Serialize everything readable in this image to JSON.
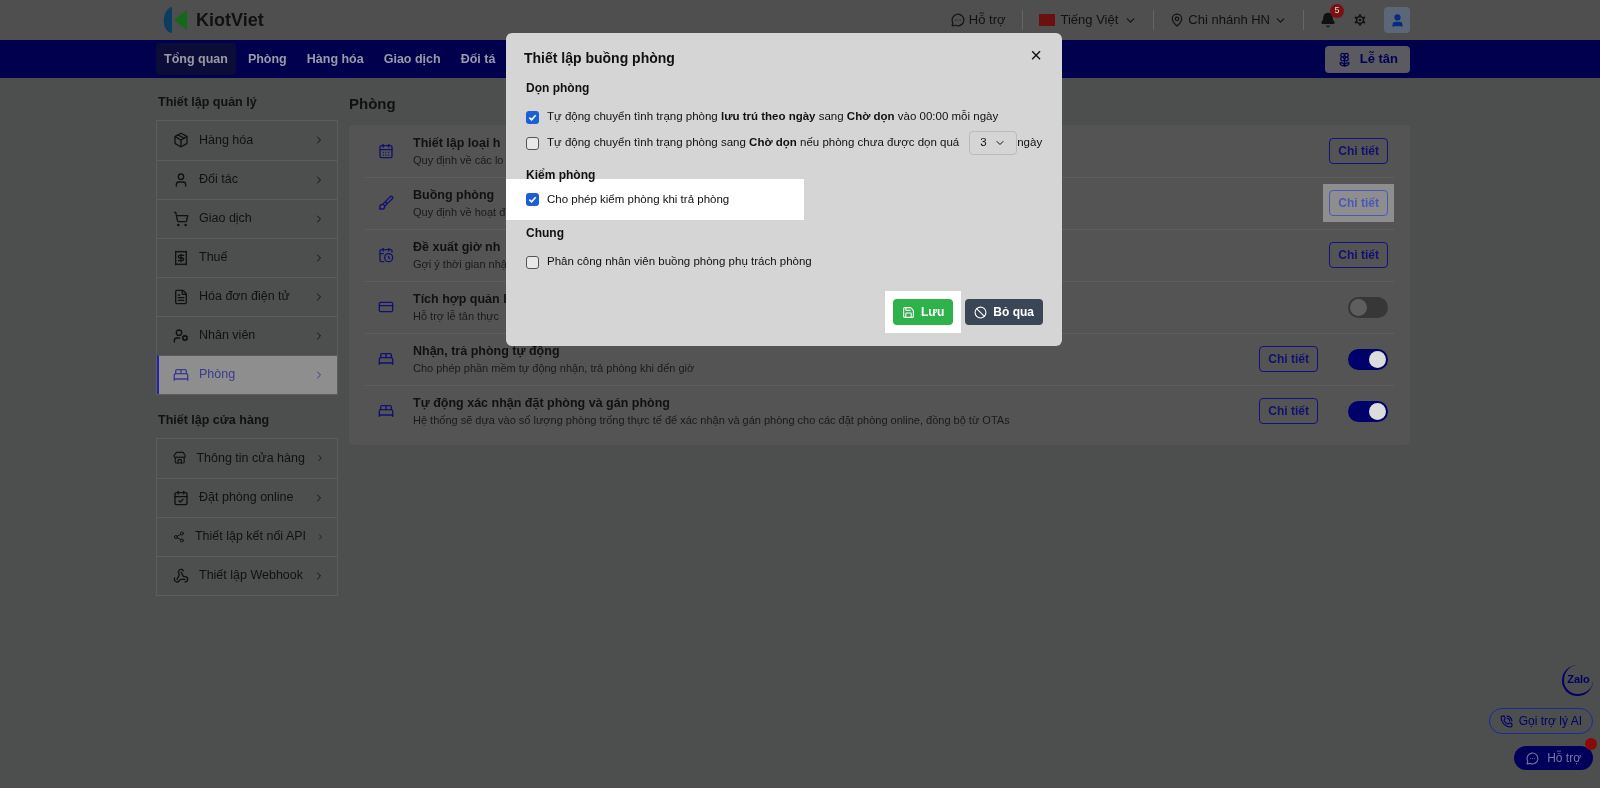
{
  "header": {
    "logo": "KiotViet",
    "support": "Hỗ trợ",
    "language": "Tiếng Việt",
    "branch": "Chi nhánh HN",
    "notification_count": "5"
  },
  "nav": {
    "tabs": [
      {
        "label": "Tổng quan",
        "selected": true
      },
      {
        "label": "Phòng",
        "selected": false
      },
      {
        "label": "Hàng hóa",
        "selected": false
      },
      {
        "label": "Giao dịch",
        "selected": false
      },
      {
        "label": "Đối tá",
        "selected": false
      }
    ],
    "reception_button": "Lễ tân"
  },
  "sidebar": [
    {
      "title": "Thiết lập quản lý",
      "items": [
        {
          "label": "Hàng hóa",
          "selected": false
        },
        {
          "label": "Đối tác",
          "selected": false
        },
        {
          "label": "Giao dịch",
          "selected": false
        },
        {
          "label": "Thuế",
          "selected": false
        },
        {
          "label": "Hóa đơn điện tử",
          "selected": false
        },
        {
          "label": "Nhân viên",
          "selected": false
        },
        {
          "label": "Phòng",
          "selected": true
        }
      ]
    },
    {
      "title": "Thiết lập cửa hàng",
      "items": [
        {
          "label": "Thông tin cửa hàng",
          "selected": false
        },
        {
          "label": "Đặt phòng online",
          "selected": false
        },
        {
          "label": "Thiết lập kết nối API",
          "selected": false
        },
        {
          "label": "Thiết lập Webhook",
          "selected": false
        }
      ]
    }
  ],
  "content": {
    "title": "Phòng",
    "rows": [
      {
        "title": "Thiết lập loại h",
        "description": "Quy định về các lo",
        "detail_button": "Chi tiết",
        "highlighted": false
      },
      {
        "title": "Buồng phòng",
        "description": "Quy định về hoạt đ",
        "detail_button": "Chi tiết",
        "highlighted": true
      },
      {
        "title": "Đề xuất giờ nh",
        "description": "Gợi ý thời gian nhậ",
        "detail_button": "Chi tiết",
        "highlighted": false
      },
      {
        "title": "Tích hợp quản l",
        "description": "Hỗ trợ lễ tân thực",
        "on": false
      },
      {
        "title": "Nhận, trả phòng tự động",
        "description": "Cho phép phần mềm tự động nhận, trả phòng khi đến giờ",
        "detail_button": "Chi tiết",
        "highlighted": false,
        "on": true
      },
      {
        "title": "Tự động xác nhận đặt phòng và gán phòng",
        "description": "Hệ thống sẽ dựa vào số lượng phòng trống thực tế để xác nhận và gán phòng cho các đặt phòng online, đồng bộ từ OTAs",
        "detail_button": "Chi tiết",
        "highlighted": false,
        "on": true
      }
    ]
  },
  "dialog": {
    "title": "Thiết lập buồng phòng",
    "close": "×",
    "sections": [
      {
        "title": "Dọn phòng",
        "options": [
          {
            "text": "Tự động chuyển tình trạng phòng **lưu trú theo ngày** sang **Chờ dọn** vào 00:00 mỗi ngày",
            "checked": true,
            "highlighted": false
          },
          {
            "text": "Tự động chuyển tình trạng phòng sang **Chờ dọn** nếu phòng chưa được dọn quá",
            "checked": false,
            "highlighted": false,
            "select_value": "3",
            "suffix": "ngày"
          }
        ]
      },
      {
        "title": "Kiểm phòng",
        "options": [
          {
            "text": "Cho phép kiểm phòng khi trả phòng",
            "checked": true,
            "highlighted": true
          }
        ]
      },
      {
        "title": "Chung",
        "options": [
          {
            "text": "Phân công nhân viên buồng phòng phụ trách phòng",
            "checked": false,
            "highlighted": false
          }
        ]
      }
    ],
    "save_button": {
      "label": "Lưu",
      "highlighted": true
    },
    "cancel_button": "Bỏ qua"
  },
  "floating": {
    "zalo": "Zalo",
    "ai_button": "Gọi trợ lý AI",
    "support_button": "Hỗ trợ"
  }
}
